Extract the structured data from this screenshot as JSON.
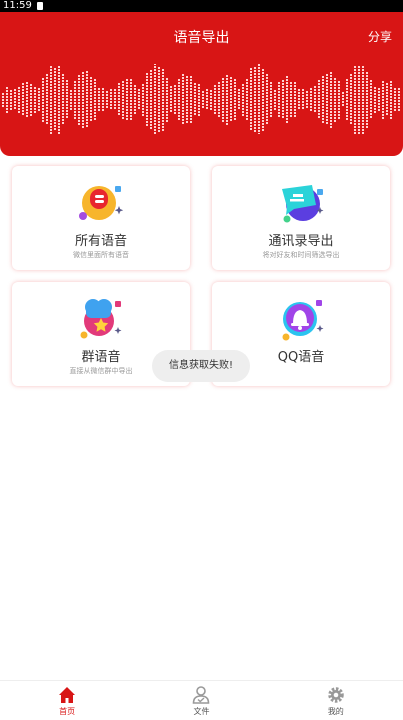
{
  "status_bar": {
    "time": "11:59"
  },
  "header": {
    "title": "语音导出",
    "share_label": "分享"
  },
  "colors": {
    "primary": "#d81515",
    "text": "#333333",
    "subtext": "#999999",
    "toast_bg": "#eeeeee"
  },
  "cards": [
    {
      "title": "所有语音",
      "subtitle": "微信里面所有语音",
      "icon": "microphone-icon"
    },
    {
      "title": "通讯录导出",
      "subtitle": "将对好友和时间筛选导出",
      "icon": "chat-bubble-icon"
    },
    {
      "title": "群语音",
      "subtitle": "直接从微信群中导出",
      "icon": "group-star-icon"
    },
    {
      "title": "QQ语音",
      "subtitle": "",
      "icon": "qq-bell-icon"
    }
  ],
  "toast": {
    "message": "信息获取失败!"
  },
  "bottom_nav": {
    "items": [
      {
        "label": "首页",
        "icon": "home-icon",
        "active": true
      },
      {
        "label": "文件",
        "icon": "user-file-icon",
        "active": false
      },
      {
        "label": "我的",
        "icon": "gear-icon",
        "active": false
      }
    ]
  }
}
